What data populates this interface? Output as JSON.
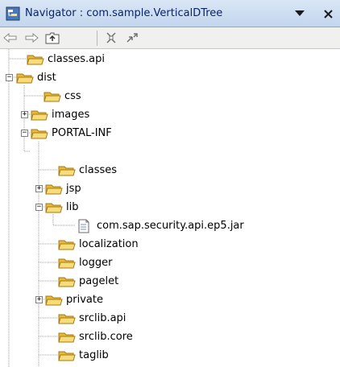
{
  "window": {
    "title": "Navigator : com.sample.VerticalDTree",
    "title_icon": "navigator-icon",
    "menu_icon": "chevron-down-icon",
    "close_icon": "close-icon"
  },
  "toolbar": {
    "buttons": [
      "back-arrow-icon",
      "forward-arrow-icon",
      "up-folder-icon",
      "collapse-all-icon",
      "link-editor-icon"
    ]
  },
  "tree": {
    "items": [
      {
        "label": "classes.api",
        "type": "folder",
        "depth": 1
      },
      {
        "label": "dist",
        "type": "folder",
        "depth": 0,
        "expanded": true
      },
      {
        "label": "css",
        "type": "folder",
        "depth": 1
      },
      {
        "label": "images",
        "type": "folder",
        "depth": 1,
        "expanded": false
      },
      {
        "label": "PORTAL-INF",
        "type": "folder",
        "depth": 1,
        "expanded": true
      },
      {
        "label": "classes",
        "type": "folder",
        "depth": 2
      },
      {
        "label": "jsp",
        "type": "folder",
        "depth": 2,
        "expanded": false
      },
      {
        "label": "lib",
        "type": "folder",
        "depth": 2,
        "expanded": true
      },
      {
        "label": "com.sap.security.api.ep5.jar",
        "type": "file",
        "depth": 3
      },
      {
        "label": "localization",
        "type": "folder",
        "depth": 2
      },
      {
        "label": "logger",
        "type": "folder",
        "depth": 2
      },
      {
        "label": "pagelet",
        "type": "folder",
        "depth": 2
      },
      {
        "label": "private",
        "type": "folder",
        "depth": 2,
        "expanded": false
      },
      {
        "label": "srclib.api",
        "type": "folder",
        "depth": 2
      },
      {
        "label": "srclib.core",
        "type": "folder",
        "depth": 2
      },
      {
        "label": "taglib",
        "type": "folder",
        "depth": 2
      }
    ]
  },
  "colors": {
    "title_bg": "#c3d6ee",
    "title_text": "#0a246a",
    "folder_fill": "#f7d36a",
    "folder_stroke": "#b08a22"
  }
}
